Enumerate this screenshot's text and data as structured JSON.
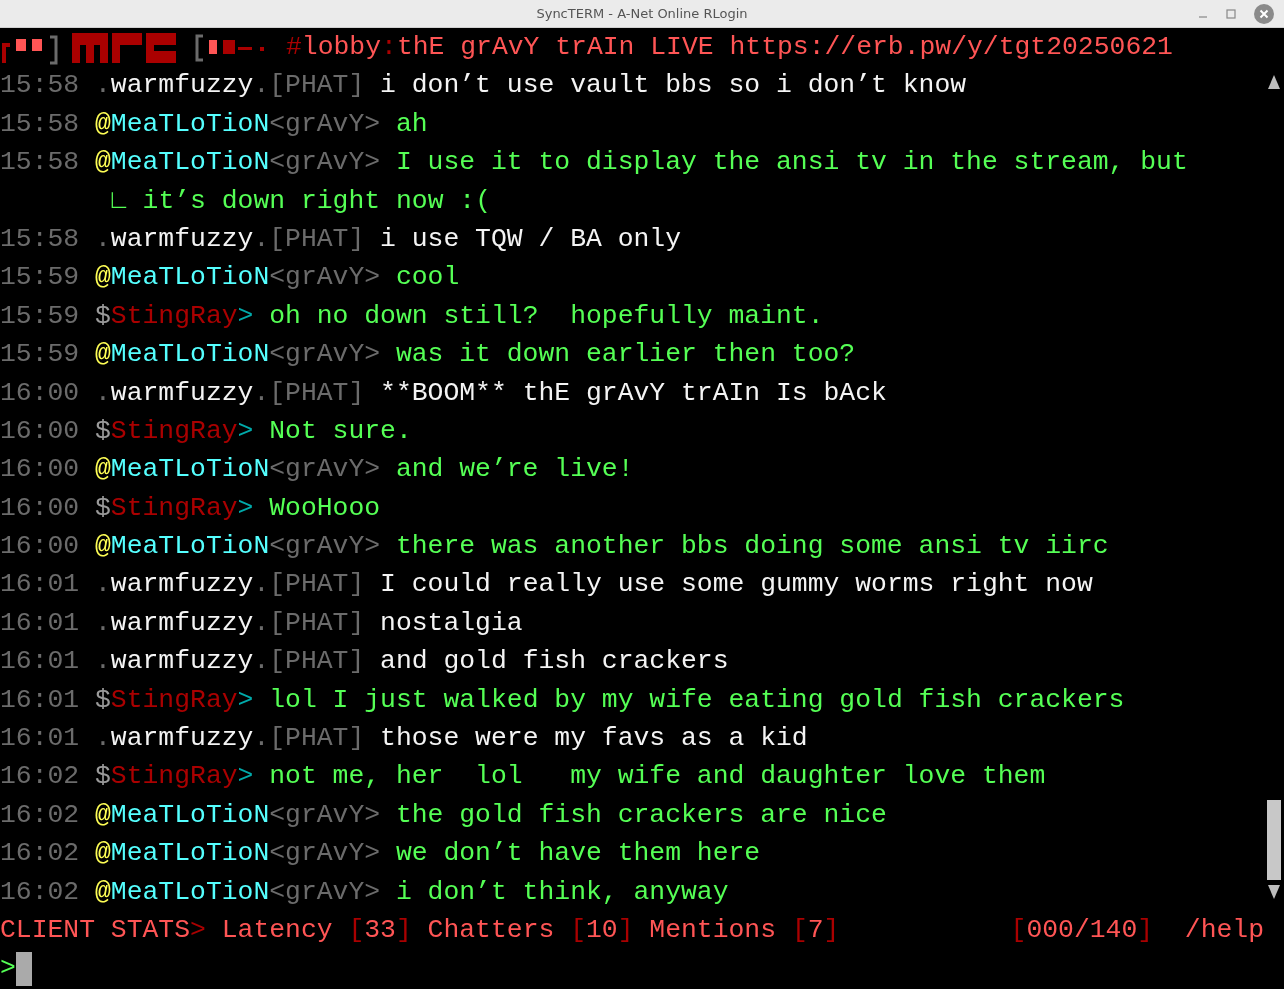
{
  "window": {
    "title": "SyncTERM - A-Net Online RLogin"
  },
  "header": {
    "hash": "#",
    "channel": "lobby",
    "separator": ":",
    "topic": "thE grAvY trAIn LIVE https://erb.pw/y/tgt20250621"
  },
  "messages": [
    {
      "time": "15:58",
      "kind": "phat",
      "prefix": ".",
      "nick": "warmfuzzy",
      "tag": ".[PHAT]",
      "text": "i don’t use vault bbs so i don’t know"
    },
    {
      "time": "15:58",
      "kind": "gravy",
      "prefix": "@",
      "nick": "MeaTLoTioN",
      "tag": "<grAvY>",
      "text": "ah"
    },
    {
      "time": "15:58",
      "kind": "gravy",
      "prefix": "@",
      "nick": "MeaTLoTioN",
      "tag": "<grAvY>",
      "text": "I use it to display the ansi tv in the stream, but",
      "wrap_mark": "∟",
      "wrap": "it’s down right now :("
    },
    {
      "time": "15:58",
      "kind": "phat",
      "prefix": ".",
      "nick": "warmfuzzy",
      "tag": ".[PHAT]",
      "text": "i use TQW / BA only"
    },
    {
      "time": "15:59",
      "kind": "gravy",
      "prefix": "@",
      "nick": "MeaTLoTioN",
      "tag": "<grAvY>",
      "text": "cool"
    },
    {
      "time": "15:59",
      "kind": "stingray",
      "prefix": "$",
      "nick": "StingRay",
      "tag": ">",
      "text": "oh no down still?  hopefully maint."
    },
    {
      "time": "15:59",
      "kind": "gravy",
      "prefix": "@",
      "nick": "MeaTLoTioN",
      "tag": "<grAvY>",
      "text": "was it down earlier then too?"
    },
    {
      "time": "16:00",
      "kind": "phat",
      "prefix": ".",
      "nick": "warmfuzzy",
      "tag": ".[PHAT]",
      "text": "**BOOM** thE grAvY trAIn Is bAck"
    },
    {
      "time": "16:00",
      "kind": "stingray",
      "prefix": "$",
      "nick": "StingRay",
      "tag": ">",
      "text": "Not sure."
    },
    {
      "time": "16:00",
      "kind": "gravy",
      "prefix": "@",
      "nick": "MeaTLoTioN",
      "tag": "<grAvY>",
      "text": "and we’re live!"
    },
    {
      "time": "16:00",
      "kind": "stingray",
      "prefix": "$",
      "nick": "StingRay",
      "tag": ">",
      "text": "WooHooo"
    },
    {
      "time": "16:00",
      "kind": "gravy",
      "prefix": "@",
      "nick": "MeaTLoTioN",
      "tag": "<grAvY>",
      "text": "there was another bbs doing some ansi tv iirc"
    },
    {
      "time": "16:01",
      "kind": "phat",
      "prefix": ".",
      "nick": "warmfuzzy",
      "tag": ".[PHAT]",
      "text": "I could really use some gummy worms right now"
    },
    {
      "time": "16:01",
      "kind": "phat",
      "prefix": ".",
      "nick": "warmfuzzy",
      "tag": ".[PHAT]",
      "text": "nostalgia"
    },
    {
      "time": "16:01",
      "kind": "phat",
      "prefix": ".",
      "nick": "warmfuzzy",
      "tag": ".[PHAT]",
      "text": "and gold fish crackers"
    },
    {
      "time": "16:01",
      "kind": "stingray",
      "prefix": "$",
      "nick": "StingRay",
      "tag": ">",
      "text": "lol I just walked by my wife eating gold fish crackers"
    },
    {
      "time": "16:01",
      "kind": "phat",
      "prefix": ".",
      "nick": "warmfuzzy",
      "tag": ".[PHAT]",
      "text": "those were my favs as a kid"
    },
    {
      "time": "16:02",
      "kind": "stingray",
      "prefix": "$",
      "nick": "StingRay",
      "tag": ">",
      "text": "not me, her  lol   my wife and daughter love them"
    },
    {
      "time": "16:02",
      "kind": "gravy",
      "prefix": "@",
      "nick": "MeaTLoTioN",
      "tag": "<grAvY>",
      "text": "the gold fish crackers are nice"
    },
    {
      "time": "16:02",
      "kind": "gravy",
      "prefix": "@",
      "nick": "MeaTLoTioN",
      "tag": "<grAvY>",
      "text": "we don’t have them here"
    },
    {
      "time": "16:02",
      "kind": "gravy",
      "prefix": "@",
      "nick": "MeaTLoTioN",
      "tag": "<grAvY>",
      "text": "i don’t think, anyway"
    }
  ],
  "status": {
    "label": "CLIENT STATS",
    "arrow": ">",
    "stats": [
      {
        "name": "Latency",
        "open": "[",
        "value": "33",
        "close": "]"
      },
      {
        "name": "Chatters",
        "open": "[",
        "value": "10",
        "close": "]"
      },
      {
        "name": "Mentions",
        "open": "[",
        "value": "7",
        "close": "]"
      }
    ],
    "counter_open": "[",
    "counter": "000/140",
    "counter_close": "]",
    "help": "/help"
  },
  "prompt": {
    "symbol": ">"
  }
}
